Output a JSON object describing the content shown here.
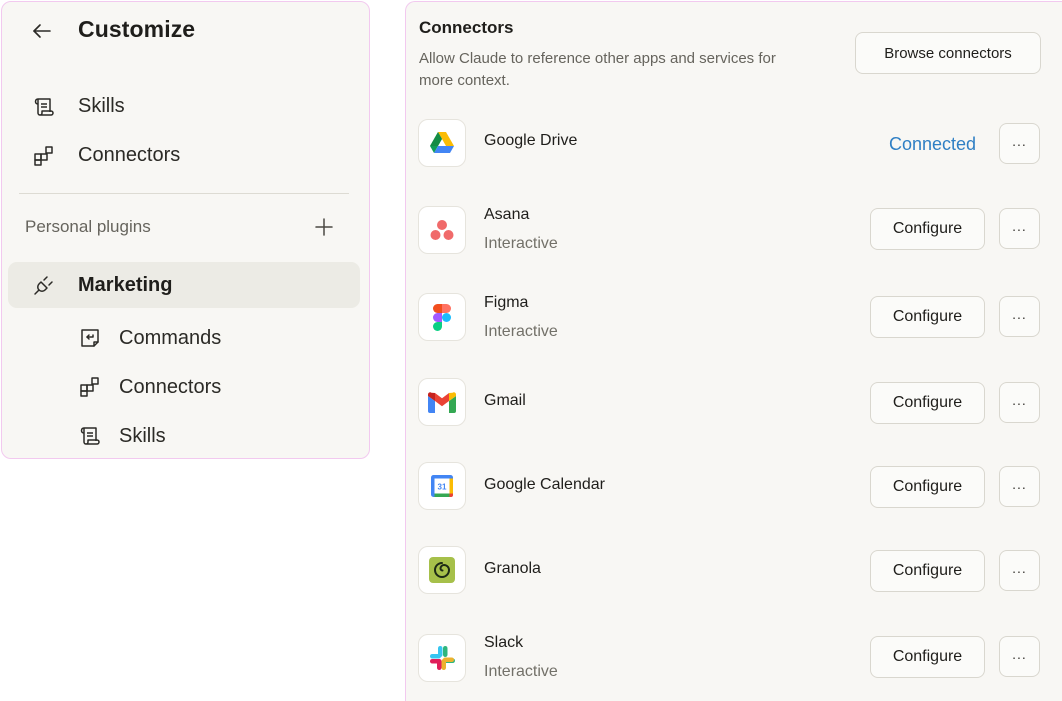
{
  "sidebar": {
    "title": "Customize",
    "items": [
      {
        "label": "Skills",
        "icon": "scroll-icon"
      },
      {
        "label": "Connectors",
        "icon": "blocks-icon"
      }
    ],
    "section_label": "Personal plugins",
    "plugin": {
      "label": "Marketing",
      "icon": "plug-icon",
      "children": [
        {
          "label": "Commands",
          "icon": "command-box-icon"
        },
        {
          "label": "Connectors",
          "icon": "blocks-icon"
        },
        {
          "label": "Skills",
          "icon": "scroll-icon"
        }
      ]
    }
  },
  "panel": {
    "title": "Connectors",
    "description": "Allow Claude to reference other apps and services for more context.",
    "browse_label": "Browse connectors",
    "more_label": "...",
    "connectors": [
      {
        "name": "Google Drive",
        "subtitle": "",
        "action": "Connected",
        "status": "connected"
      },
      {
        "name": "Asana",
        "subtitle": "Interactive",
        "action": "Configure"
      },
      {
        "name": "Figma",
        "subtitle": "Interactive",
        "action": "Configure"
      },
      {
        "name": "Gmail",
        "subtitle": "",
        "action": "Configure"
      },
      {
        "name": "Google Calendar",
        "subtitle": "",
        "action": "Configure"
      },
      {
        "name": "Granola",
        "subtitle": "",
        "action": "Configure"
      },
      {
        "name": "Slack",
        "subtitle": "Interactive",
        "action": "Configure"
      }
    ]
  },
  "colors": {
    "accent_link": "#2f7fc4",
    "border_highlight": "#f2c9ef",
    "panel_bg": "#f8f7f4"
  }
}
